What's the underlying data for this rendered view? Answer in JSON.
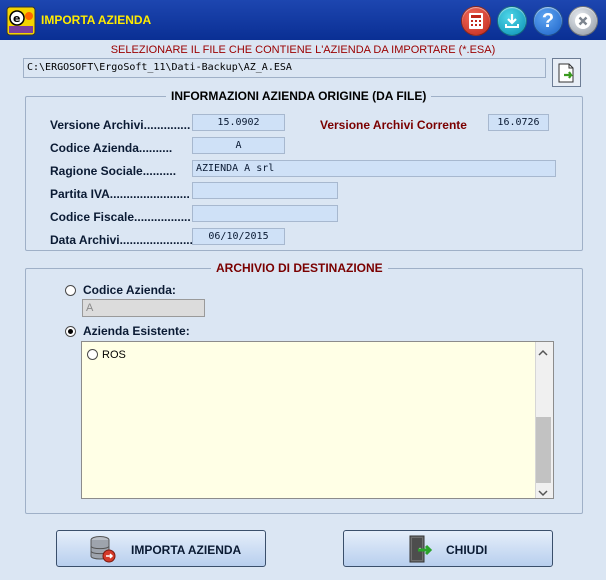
{
  "window": {
    "title": "IMPORTA AZIENDA",
    "help_label": "?"
  },
  "file_select": {
    "instruction": "SELEZIONARE IL FILE CHE CONTIENE L'AZIENDA DA IMPORTARE (*.ESA)",
    "path": "C:\\ERGOSOFT\\ErgoSoft_11\\Dati-Backup\\AZ_A.ESA"
  },
  "origin_info": {
    "title": "INFORMAZIONI AZIENDA ORIGINE (DA FILE)",
    "versione_archivi_label": "Versione Archivi",
    "versione_archivi_value": "15.0902",
    "versione_corrente_label": "Versione Archivi Corrente",
    "versione_corrente_value": "16.0726",
    "codice_azienda_label": "Codice Azienda",
    "codice_azienda_value": "A",
    "ragione_sociale_label": "Ragione Sociale",
    "ragione_sociale_value": "AZIENDA A srl",
    "partita_iva_label": "Partita IVA",
    "partita_iva_value": "",
    "codice_fiscale_label": "Codice Fiscale",
    "codice_fiscale_value": "",
    "data_archivi_label": "Data Archivi",
    "data_archivi_value": "06/10/2015"
  },
  "destination": {
    "title": "ARCHIVIO DI DESTINAZIONE",
    "codice_azienda_label": "Codice Azienda:",
    "codice_azienda_value": "A",
    "azienda_esistente_label": "Azienda Esistente:",
    "selected_option": "Azienda Esistente",
    "companies": [
      "ROS"
    ]
  },
  "buttons": {
    "import_label": "IMPORTA AZIENDA",
    "close_label": "CHIUDI"
  },
  "colors": {
    "titlebar": "#0a2f94",
    "title_text": "#ffeb00",
    "background": "#dbe6f3",
    "field": "#cfe1f7",
    "list": "#ffffe6",
    "accent_red": "#9a0000"
  }
}
